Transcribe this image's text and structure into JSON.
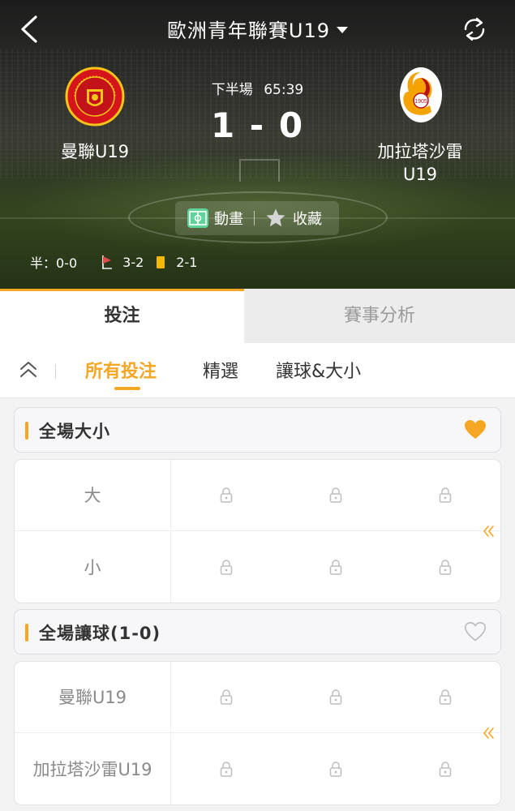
{
  "header": {
    "title": "歐洲青年聯賽U19",
    "period": "下半場",
    "clock": "65:39",
    "score": "1 - 0",
    "home_team": "曼聯U19",
    "away_team": "加拉塔沙雷\nU19",
    "actions": {
      "animation_label": "動畫",
      "favorite_label": "收藏"
    },
    "stats": {
      "half_label": "半：0-0",
      "corners": "3-2",
      "yellow_cards": "2-1"
    }
  },
  "main_tabs": [
    {
      "label": "投注",
      "active": true
    },
    {
      "label": "賽事分析",
      "active": false
    }
  ],
  "sub_tabs": [
    {
      "label": "所有投注",
      "active": true
    },
    {
      "label": "精選",
      "active": false
    },
    {
      "label": "讓球&大小",
      "active": false
    }
  ],
  "markets": [
    {
      "title": "全場大小",
      "favorited": true,
      "rows": [
        "大",
        "小"
      ],
      "locked": true
    },
    {
      "title": "全場讓球(1-0)",
      "favorited": false,
      "rows": [
        "曼聯U19",
        "加拉塔沙雷U19"
      ],
      "locked": true
    }
  ],
  "colors": {
    "accent": "#f5a623",
    "yellow_card": "#f5b800",
    "heart_filled": "#f5a623",
    "heart_outline": "#b9b9c0"
  }
}
